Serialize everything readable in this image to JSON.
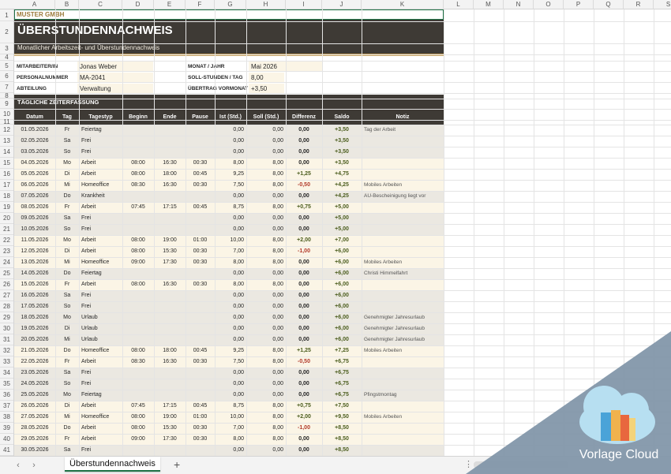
{
  "columns": [
    "A",
    "B",
    "C",
    "D",
    "E",
    "F",
    "G",
    "H",
    "I",
    "J",
    "K",
    "L",
    "M",
    "N",
    "O",
    "P",
    "Q",
    "R",
    "S"
  ],
  "rows": [
    "1",
    "2",
    "3",
    "4",
    "5",
    "6",
    "7",
    "8",
    "9",
    "10",
    "11",
    "12",
    "13",
    "14",
    "15",
    "16",
    "17",
    "18",
    "19",
    "20",
    "21",
    "22",
    "23",
    "24",
    "25",
    "26",
    "27",
    "28",
    "29",
    "30",
    "31",
    "32",
    "33",
    "34",
    "35",
    "36",
    "37",
    "38",
    "39",
    "40",
    "41"
  ],
  "company": "MUSTER GMBH",
  "title": "ÜBERSTUNDENNACHWEIS",
  "subtitle": "Monatlicher Arbeitszeit- und Überstundennachweis",
  "info_left": [
    {
      "label": "MITARBEITER/IN",
      "value": "Jonas Weber"
    },
    {
      "label": "PERSONALNUMMER",
      "value": "MA-2041"
    },
    {
      "label": "ABTEILUNG",
      "value": "Verwaltung"
    }
  ],
  "info_right": [
    {
      "label": "MONAT / JAHR",
      "value": "Mai 2026"
    },
    {
      "label": "SOLL-STUNDEN / TAG",
      "value": "8,00"
    },
    {
      "label": "ÜBERTRAG VORMONAT",
      "value": "+3,50"
    }
  ],
  "section_title": "TÄGLICHE ZEITERFASSUNG",
  "headers": [
    "Datum",
    "Tag",
    "Tagestyp",
    "Beginn",
    "Ende",
    "Pause",
    "Ist (Std.)",
    "Soll (Std.)",
    "Differenz",
    "Saldo",
    "Notiz"
  ],
  "entries": [
    [
      "01.05.2026",
      "Fr",
      "Feiertag",
      "",
      "",
      "",
      "0,00",
      "0,00",
      "0,00",
      "+3,50",
      "Tag der Arbeit"
    ],
    [
      "02.05.2026",
      "Sa",
      "Frei",
      "",
      "",
      "",
      "0,00",
      "0,00",
      "0,00",
      "+3,50",
      ""
    ],
    [
      "03.05.2026",
      "So",
      "Frei",
      "",
      "",
      "",
      "0,00",
      "0,00",
      "0,00",
      "+3,50",
      ""
    ],
    [
      "04.05.2026",
      "Mo",
      "Arbeit",
      "08:00",
      "16:30",
      "00:30",
      "8,00",
      "8,00",
      "0,00",
      "+3,50",
      ""
    ],
    [
      "05.05.2026",
      "Di",
      "Arbeit",
      "08:00",
      "18:00",
      "00:45",
      "9,25",
      "8,00",
      "+1,25",
      "+4,75",
      ""
    ],
    [
      "06.05.2026",
      "Mi",
      "Homeoffice",
      "08:30",
      "16:30",
      "00:30",
      "7,50",
      "8,00",
      "-0,50",
      "+4,25",
      "Mobiles Arbeiten"
    ],
    [
      "07.05.2026",
      "Do",
      "Krankheit",
      "",
      "",
      "",
      "0,00",
      "0,00",
      "0,00",
      "+4,25",
      "AU-Bescheinigung liegt vor"
    ],
    [
      "08.05.2026",
      "Fr",
      "Arbeit",
      "07:45",
      "17:15",
      "00:45",
      "8,75",
      "8,00",
      "+0,75",
      "+5,00",
      ""
    ],
    [
      "09.05.2026",
      "Sa",
      "Frei",
      "",
      "",
      "",
      "0,00",
      "0,00",
      "0,00",
      "+5,00",
      ""
    ],
    [
      "10.05.2026",
      "So",
      "Frei",
      "",
      "",
      "",
      "0,00",
      "0,00",
      "0,00",
      "+5,00",
      ""
    ],
    [
      "11.05.2026",
      "Mo",
      "Arbeit",
      "08:00",
      "19:00",
      "01:00",
      "10,00",
      "8,00",
      "+2,00",
      "+7,00",
      ""
    ],
    [
      "12.05.2026",
      "Di",
      "Arbeit",
      "08:00",
      "15:30",
      "00:30",
      "7,00",
      "8,00",
      "-1,00",
      "+6,00",
      ""
    ],
    [
      "13.05.2026",
      "Mi",
      "Homeoffice",
      "09:00",
      "17:30",
      "00:30",
      "8,00",
      "8,00",
      "0,00",
      "+6,00",
      "Mobiles Arbeiten"
    ],
    [
      "14.05.2026",
      "Do",
      "Feiertag",
      "",
      "",
      "",
      "0,00",
      "0,00",
      "0,00",
      "+6,00",
      "Christi Himmelfahrt"
    ],
    [
      "15.05.2026",
      "Fr",
      "Arbeit",
      "08:00",
      "16:30",
      "00:30",
      "8,00",
      "8,00",
      "0,00",
      "+6,00",
      ""
    ],
    [
      "16.05.2026",
      "Sa",
      "Frei",
      "",
      "",
      "",
      "0,00",
      "0,00",
      "0,00",
      "+6,00",
      ""
    ],
    [
      "17.05.2026",
      "So",
      "Frei",
      "",
      "",
      "",
      "0,00",
      "0,00",
      "0,00",
      "+6,00",
      ""
    ],
    [
      "18.05.2026",
      "Mo",
      "Urlaub",
      "",
      "",
      "",
      "0,00",
      "0,00",
      "0,00",
      "+6,00",
      "Genehmigter Jahresurlaub"
    ],
    [
      "19.05.2026",
      "Di",
      "Urlaub",
      "",
      "",
      "",
      "0,00",
      "0,00",
      "0,00",
      "+6,00",
      "Genehmigter Jahresurlaub"
    ],
    [
      "20.05.2026",
      "Mi",
      "Urlaub",
      "",
      "",
      "",
      "0,00",
      "0,00",
      "0,00",
      "+6,00",
      "Genehmigter Jahresurlaub"
    ],
    [
      "21.05.2026",
      "Do",
      "Homeoffice",
      "08:00",
      "18:00",
      "00:45",
      "9,25",
      "8,00",
      "+1,25",
      "+7,25",
      "Mobiles Arbeiten"
    ],
    [
      "22.05.2026",
      "Fr",
      "Arbeit",
      "08:30",
      "16:30",
      "00:30",
      "7,50",
      "8,00",
      "-0,50",
      "+6,75",
      ""
    ],
    [
      "23.05.2026",
      "Sa",
      "Frei",
      "",
      "",
      "",
      "0,00",
      "0,00",
      "0,00",
      "+6,75",
      ""
    ],
    [
      "24.05.2026",
      "So",
      "Frei",
      "",
      "",
      "",
      "0,00",
      "0,00",
      "0,00",
      "+6,75",
      ""
    ],
    [
      "25.05.2026",
      "Mo",
      "Feiertag",
      "",
      "",
      "",
      "0,00",
      "0,00",
      "0,00",
      "+6,75",
      "Pfingstmontag"
    ],
    [
      "26.05.2026",
      "Di",
      "Arbeit",
      "07:45",
      "17:15",
      "00:45",
      "8,75",
      "8,00",
      "+0,75",
      "+7,50",
      ""
    ],
    [
      "27.05.2026",
      "Mi",
      "Homeoffice",
      "08:00",
      "19:00",
      "01:00",
      "10,00",
      "8,00",
      "+2,00",
      "+9,50",
      "Mobiles Arbeiten"
    ],
    [
      "28.05.2026",
      "Do",
      "Arbeit",
      "08:00",
      "15:30",
      "00:30",
      "7,00",
      "8,00",
      "-1,00",
      "+8,50",
      ""
    ],
    [
      "29.05.2026",
      "Fr",
      "Arbeit",
      "09:00",
      "17:30",
      "00:30",
      "8,00",
      "8,00",
      "0,00",
      "+8,50",
      ""
    ],
    [
      "30.05.2026",
      "Sa",
      "Frei",
      "",
      "",
      "",
      "0,00",
      "0,00",
      "0,00",
      "+8,50",
      ""
    ]
  ],
  "sheet_tab": "Überstundennachweis",
  "add_sheet": "+",
  "nav_prev": "‹",
  "nav_next": "›",
  "tab_more": "⋮",
  "watermark": {
    "brand": "Vorlage Cloud"
  },
  "colors": {
    "banner": "#3e3a35",
    "accent": "#c9a25e",
    "company_text": "#9a7a3a",
    "workday_fill": "#fbf5e6",
    "offday_fill": "#ebe8e1",
    "positive": "#4b5d1e",
    "negative": "#b23a2a",
    "watermark_band": "#7f94a7",
    "cloud": "#b7dff1"
  }
}
